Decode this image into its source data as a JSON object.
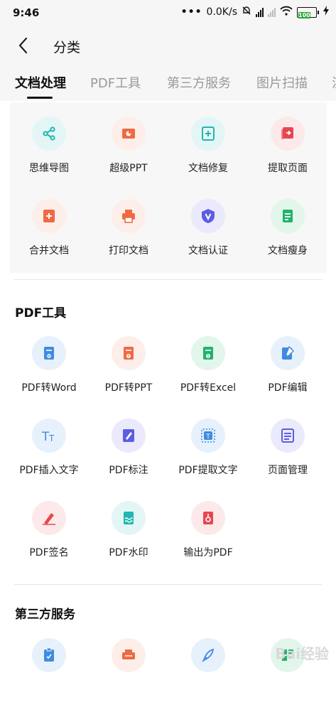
{
  "status_bar": {
    "time": "9:46",
    "network_speed": "0.0K/s",
    "battery": "100"
  },
  "header": {
    "title": "分类",
    "back_icon": "chevron-left-icon"
  },
  "tabs": [
    {
      "label": "文档处理",
      "active": true
    },
    {
      "label": "PDF工具",
      "active": false
    },
    {
      "label": "第三方服务",
      "active": false
    },
    {
      "label": "图片扫描",
      "active": false
    },
    {
      "label": "流",
      "active": false
    }
  ],
  "sections": {
    "doc": {
      "items": [
        {
          "label": "思维导图",
          "icon": "mind-map-icon",
          "bg": "#e3f6f5",
          "fg": "#1fb7b0"
        },
        {
          "label": "超级PPT",
          "icon": "ppt-icon",
          "bg": "#fdeee9",
          "fg": "#ef6a43"
        },
        {
          "label": "文档修复",
          "icon": "doc-repair-icon",
          "bg": "#e3f6f5",
          "fg": "#1fb7b0"
        },
        {
          "label": "提取页面",
          "icon": "extract-page-icon",
          "bg": "#fde9ea",
          "fg": "#e8474f"
        },
        {
          "label": "合并文档",
          "icon": "merge-doc-icon",
          "bg": "#fdeee9",
          "fg": "#ef6a43"
        },
        {
          "label": "打印文档",
          "icon": "print-icon",
          "bg": "#fdeee9",
          "fg": "#ef6a43"
        },
        {
          "label": "文档认证",
          "icon": "verify-icon",
          "bg": "#eaeafc",
          "fg": "#5b5ee0"
        },
        {
          "label": "文档瘦身",
          "icon": "doc-slim-icon",
          "bg": "#e2f6ec",
          "fg": "#22b26c"
        }
      ]
    },
    "pdf": {
      "title": "PDF工具",
      "items": [
        {
          "label": "PDF转Word",
          "icon": "pdf-to-word-icon",
          "bg": "#e6f1fc",
          "fg": "#3f8be0"
        },
        {
          "label": "PDF转PPT",
          "icon": "pdf-to-ppt-icon",
          "bg": "#fdeee9",
          "fg": "#ef6a43"
        },
        {
          "label": "PDF转Excel",
          "icon": "pdf-to-excel-icon",
          "bg": "#e2f6ec",
          "fg": "#22b26c"
        },
        {
          "label": "PDF编辑",
          "icon": "pdf-edit-icon",
          "bg": "#e6f1fc",
          "fg": "#3f8be0"
        },
        {
          "label": "PDF插入文字",
          "icon": "text-insert-icon",
          "bg": "#e6f1fc",
          "fg": "#3f8be0"
        },
        {
          "label": "PDF标注",
          "icon": "annotate-icon",
          "bg": "#eaeafc",
          "fg": "#5b5ee0"
        },
        {
          "label": "PDF提取文字",
          "icon": "extract-text-icon",
          "bg": "#e6f1fc",
          "fg": "#3f8be0"
        },
        {
          "label": "页面管理",
          "icon": "page-manage-icon",
          "bg": "#eaeafc",
          "fg": "#5b5ee0"
        },
        {
          "label": "PDF签名",
          "icon": "signature-icon",
          "bg": "#fde9ea",
          "fg": "#e8474f"
        },
        {
          "label": "PDF水印",
          "icon": "watermark-icon",
          "bg": "#e3f6f5",
          "fg": "#1fb7b0"
        },
        {
          "label": "输出为PDF",
          "icon": "export-pdf-icon",
          "bg": "#fde9ea",
          "fg": "#e8474f"
        }
      ]
    },
    "third": {
      "title": "第三方服务",
      "items": [
        {
          "label": "",
          "icon": "clipboard-icon",
          "bg": "#e6f1fc",
          "fg": "#3f8be0"
        },
        {
          "label": "",
          "icon": "printer-service-icon",
          "bg": "#fdeee9",
          "fg": "#ef6a43"
        },
        {
          "label": "",
          "icon": "quill-icon",
          "bg": "#e6f1fc",
          "fg": "#3f8be0"
        },
        {
          "label": "",
          "icon": "qr-scan-icon",
          "bg": "#e2f6ec",
          "fg": "#22b26c"
        }
      ]
    }
  },
  "watermark": "Bai经验"
}
